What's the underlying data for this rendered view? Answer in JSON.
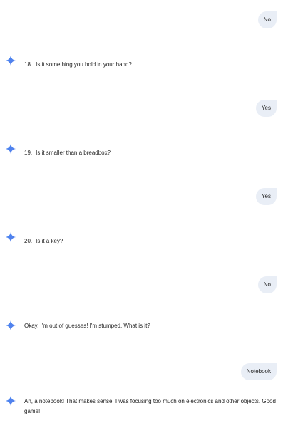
{
  "chat": {
    "messages": [
      {
        "role": "user",
        "text": "No"
      },
      {
        "role": "model",
        "number": "18.",
        "text": "Is it something you hold in your hand?"
      },
      {
        "role": "user",
        "text": "Yes"
      },
      {
        "role": "model",
        "number": "19.",
        "text": "Is it smaller than a breadbox?"
      },
      {
        "role": "user",
        "text": "Yes"
      },
      {
        "role": "model",
        "number": "20.",
        "text": "Is it a key?"
      },
      {
        "role": "user",
        "text": "No"
      },
      {
        "role": "model",
        "text": "Okay, I'm out of guesses!  I'm stumped. What is it?"
      },
      {
        "role": "user",
        "text": "Notebook"
      },
      {
        "role": "model",
        "text": "Ah, a notebook!  That makes sense.  I was focusing too much on electronics and other objects.  Good game!"
      }
    ]
  },
  "icons": {
    "model_avatar": "sparkle-icon",
    "sparkle_color_start": "#4285f4",
    "sparkle_color_end": "#9b72cb"
  },
  "colors": {
    "user_bubble_bg": "#e9eef6",
    "text": "#1f1f1f"
  }
}
